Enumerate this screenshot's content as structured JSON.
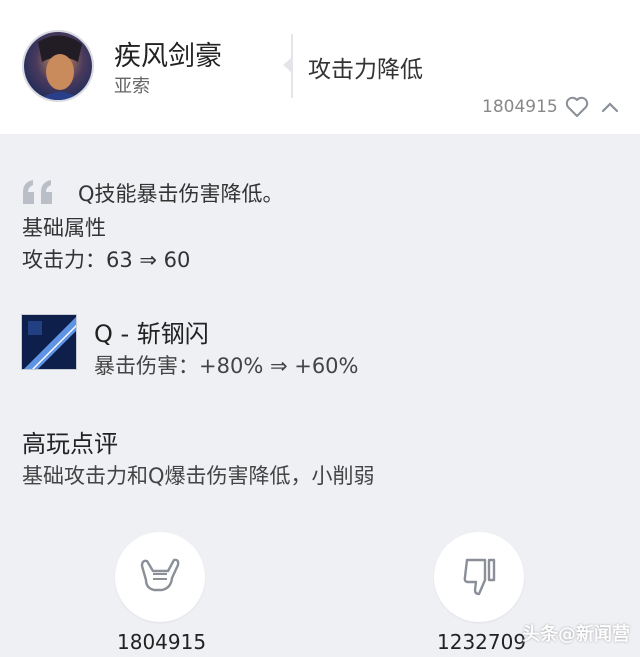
{
  "header": {
    "hero_name": "疾风剑豪",
    "hero_subtitle": "亚索",
    "change_title": "攻击力降低",
    "likes": "1804915"
  },
  "change": {
    "description": "Q技能暴击伤害降低。",
    "section_label": "基础属性",
    "stat_line": "攻击力：63 ⇒ 60"
  },
  "skill": {
    "name": "Q - 斩钢闪",
    "stat": "暴击伤害：+80% ⇒ +60%"
  },
  "review": {
    "title": "高玩点评",
    "text": "基础攻击力和Q爆击伤害降低，小削弱"
  },
  "votes": {
    "like_count": "1804915",
    "dislike_count": "1232709"
  },
  "watermark": "头条@新闻营",
  "colors": {
    "background": "#eef0f4",
    "card": "#ffffff",
    "icon_gray": "#8a8f98"
  },
  "icons": {
    "heart": "heart-icon",
    "collapse": "chevron-up-icon",
    "quote": "quote-icon",
    "like": "hang-loose-hand-icon",
    "dislike": "thumbs-down-icon"
  }
}
